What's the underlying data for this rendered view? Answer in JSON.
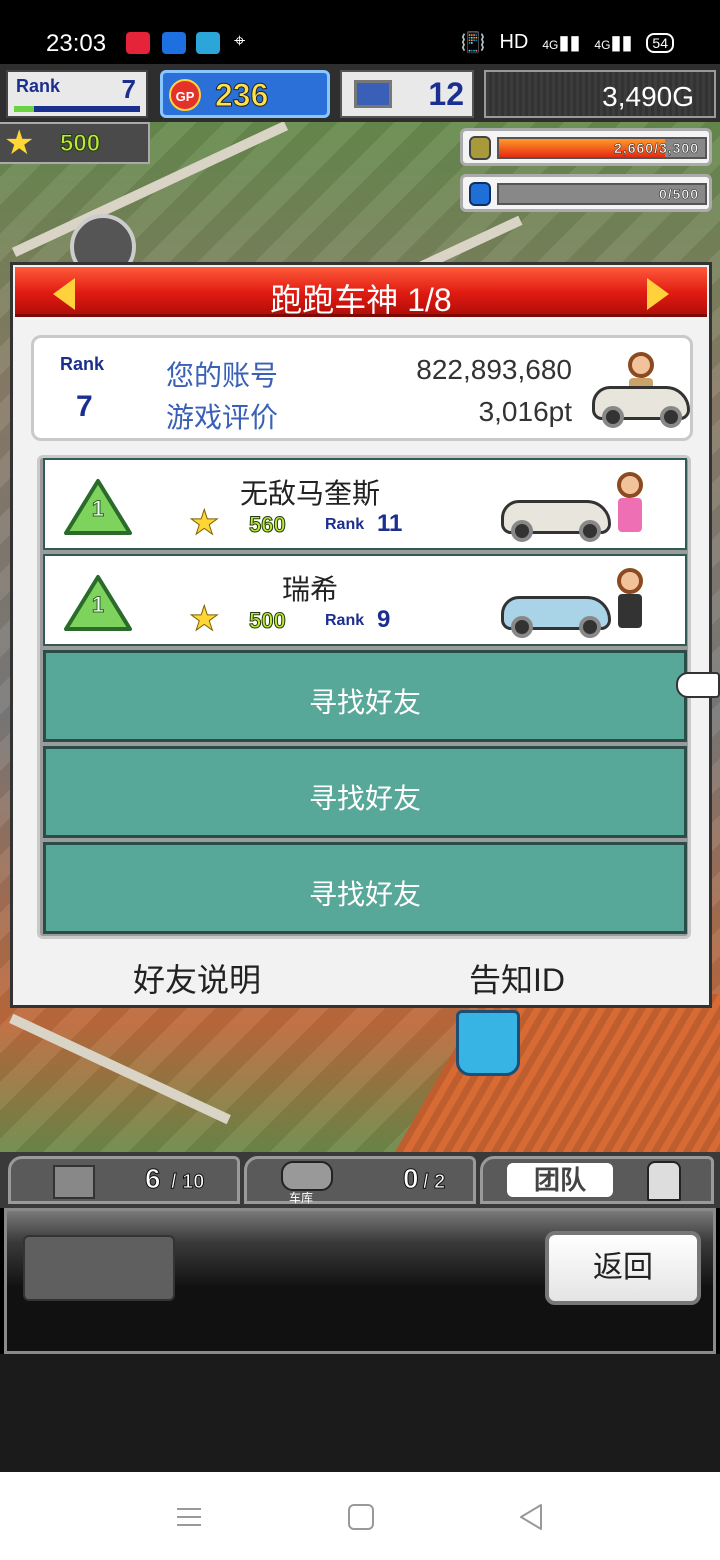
{
  "status_bar": {
    "time": "23:03",
    "network": "HD",
    "signal1": "4G",
    "signal2": "4G",
    "battery": "54"
  },
  "hud": {
    "rank_label": "Rank",
    "rank_value": "7",
    "gp_icon": "GP",
    "gp_value": "236",
    "pc_value": "12",
    "gold": "3,490G",
    "stars": "500",
    "money_meter": "2,660/3,300",
    "money_meter_fill": 0.806,
    "water_meter": "0/500",
    "water_meter_fill": 0.0
  },
  "dialog": {
    "title": "跑跑车神 1/8",
    "account": {
      "rank_label": "Rank",
      "rank_value": "7",
      "id_label": "您的账号",
      "id_value": "822,893,680",
      "rating_label": "游戏评价",
      "rating_value": "3,016pt"
    },
    "friends": [
      {
        "place": "1",
        "name": "无敌马奎斯",
        "stars": "560",
        "rank_label": "Rank",
        "rank": "11"
      },
      {
        "place": "1",
        "name": "瑞希",
        "stars": "500",
        "rank_label": "Rank",
        "rank": "9"
      }
    ],
    "find_friend_label": "寻找好友",
    "find_friend_rows": [
      "寻找好友",
      "寻找好友",
      "寻找好友"
    ],
    "footer": {
      "help": "好友说明",
      "share_id": "告知ID"
    }
  },
  "bottom": {
    "tab1_count": "6",
    "tab1_max": "10",
    "tab2_label": "车库",
    "tab2_count": "0",
    "tab2_max": "2",
    "tab3_label": "团队",
    "back_button": "返回"
  },
  "colors": {
    "header_red": "#e01b12",
    "find_teal": "#58a899",
    "rank_blue": "#1b2f8e",
    "gp_blue": "#2b6fd9",
    "star_yellow": "#ffd635"
  }
}
